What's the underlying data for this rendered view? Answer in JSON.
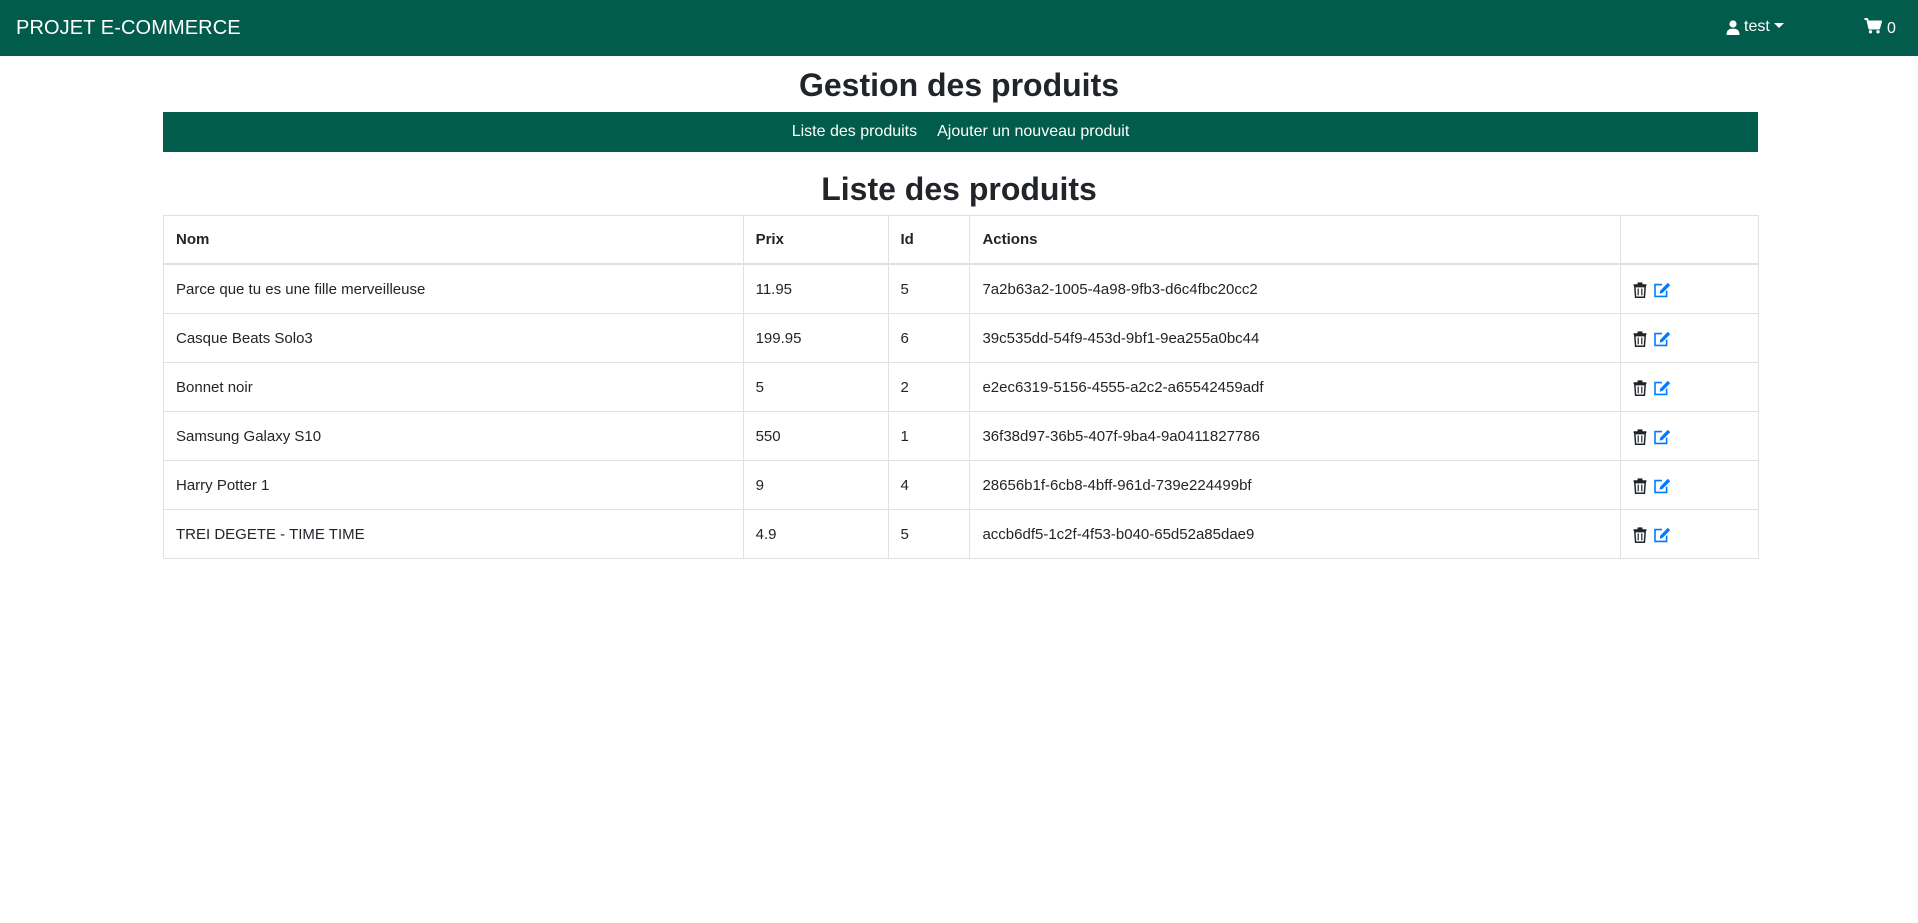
{
  "navbar": {
    "brand": "PROJET E-COMMERCE",
    "user_label": "test",
    "cart_count": "0"
  },
  "page": {
    "title": "Gestion des produits",
    "subnav": {
      "list_link": "Liste des produits",
      "add_link": "Ajouter un nouveau produit"
    },
    "list_title": "Liste des produits"
  },
  "table": {
    "headers": {
      "name": "Nom",
      "price": "Prix",
      "id": "Id",
      "actions": "Actions",
      "extra": ""
    },
    "rows": [
      {
        "name": "Parce que tu es une fille merveilleuse",
        "price": "11.95",
        "id": "5",
        "uuid": "7a2b63a2-1005-4a98-9fb3-d6c4fbc20cc2"
      },
      {
        "name": "Casque Beats Solo3",
        "price": "199.95",
        "id": "6",
        "uuid": "39c535dd-54f9-453d-9bf1-9ea255a0bc44"
      },
      {
        "name": "Bonnet noir",
        "price": "5",
        "id": "2",
        "uuid": "e2ec6319-5156-4555-a2c2-a65542459adf"
      },
      {
        "name": "Samsung Galaxy S10",
        "price": "550",
        "id": "1",
        "uuid": "36f38d97-36b5-407f-9ba4-9a0411827786"
      },
      {
        "name": "Harry Potter 1",
        "price": "9",
        "id": "4",
        "uuid": "28656b1f-6cb8-4bff-961d-739e224499bf"
      },
      {
        "name": "TREI DEGETE - TIME TIME",
        "price": "4.9",
        "id": "5",
        "uuid": "accb6df5-1c2f-4f53-b040-65d52a85dae9"
      }
    ]
  },
  "icons": {
    "user": "user-icon",
    "cart": "cart-icon",
    "delete": "trash-icon",
    "edit": "edit-icon"
  },
  "colors": {
    "brand_green": "#025c4b",
    "edit_blue": "#007bff"
  }
}
